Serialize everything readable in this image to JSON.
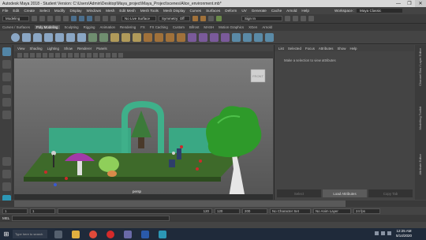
{
  "window": {
    "title": "Autodesk Maya 2018 - Student Version: C:\\Users\\Admin\\Desktop\\Maya_project\\Maya_Project\\scenes\\Alice_environment.mb*",
    "controls": [
      "—",
      "❐",
      "✕"
    ]
  },
  "menubar": {
    "items": [
      "File",
      "Edit",
      "Create",
      "Select",
      "Modify",
      "Display",
      "Windows",
      "Mesh",
      "Edit Mesh",
      "Mesh Tools",
      "Mesh Display",
      "Curves",
      "Surfaces",
      "Deform",
      "UV",
      "Generate",
      "Cache",
      "Arnold",
      "Help"
    ],
    "workspace_label": "Workspace :",
    "workspace_value": "Maya Classic"
  },
  "statusline": {
    "menuset": "Modeling",
    "surface": "No Live Surface",
    "symmetry": "Symmetry: Off",
    "signin": "Sign In"
  },
  "shelf": {
    "tabs": [
      "Curves / Surfaces",
      "Poly Modeling",
      "Sculpting",
      "Rigging",
      "Animation",
      "Rendering",
      "FX",
      "FX Caching",
      "Custom",
      "Bifrost",
      "MASH",
      "Motion Graphics",
      "XGen",
      "Arnold"
    ],
    "active_tab": "Poly Modeling"
  },
  "viewport": {
    "menu": [
      "View",
      "Shading",
      "Lighting",
      "Show",
      "Renderer",
      "Panels"
    ],
    "camera": "persp",
    "viewcube": "FRONT"
  },
  "attribute_editor": {
    "menu": [
      "List",
      "Selected",
      "Focus",
      "Attributes",
      "Show",
      "Help"
    ],
    "message": "Make a selection to view attributes",
    "buttons": [
      "Select",
      "Load Attributes",
      "Copy Tab"
    ]
  },
  "side_tabs": [
    "Channel Box / Layer Editor",
    "Modelling Toolkit",
    "Attribute Editor"
  ],
  "time": {
    "start": "1",
    "range_start": "1",
    "current": "120",
    "range_end": "120",
    "end": "200",
    "character_set": "No Character Set",
    "anim_layer": "No Anim Layer",
    "fps": "24 fps"
  },
  "mel_label": "MEL",
  "taskbar": {
    "search": "Type here to search",
    "time": "12:25 AM",
    "date": "5/14/2020"
  },
  "colors": {
    "ground": "#3e6a2a",
    "wall": "#3aa884",
    "tree_canopy": "#2e9a2a",
    "mushroom_cap": "#a23aa8"
  }
}
